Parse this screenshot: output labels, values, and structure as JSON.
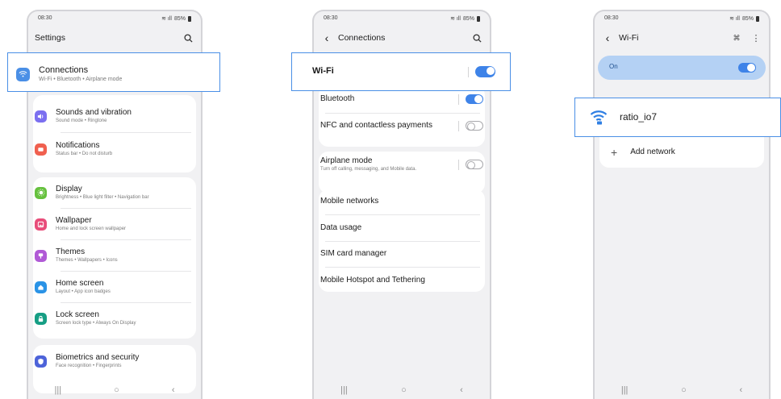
{
  "status_bar": {
    "time": "08:30",
    "battery": "85%"
  },
  "settings": {
    "title": "Settings",
    "items": [
      {
        "title": "Connections",
        "sub": "Wi-Fi  •  Bluetooth  •  Airplane mode",
        "icon": "wifi-icon",
        "color": "#4a8fe6"
      },
      {
        "title": "Sounds and vibration",
        "sub": "Sound mode  •  Ringtone",
        "icon": "speaker-icon",
        "color": "#7b6ff0"
      },
      {
        "title": "Notifications",
        "sub": "Status bar  •  Do not disturb",
        "icon": "notification-icon",
        "color": "#f0604f"
      },
      {
        "title": "Display",
        "sub": "Brightness  •  Blue light filter  •  Navigation bar",
        "icon": "sun-icon",
        "color": "#66c13e"
      },
      {
        "title": "Wallpaper",
        "sub": "Home and lock screen wallpaper",
        "icon": "image-icon",
        "color": "#e84d7a"
      },
      {
        "title": "Themes",
        "sub": "Themes  •  Wallpapers  •  Icons",
        "icon": "palette-icon",
        "color": "#b05ad6"
      },
      {
        "title": "Home screen",
        "sub": "Layout  •  App icon badges",
        "icon": "home-icon",
        "color": "#2a93e6"
      },
      {
        "title": "Lock screen",
        "sub": "Screen lock type  •  Always On Display",
        "icon": "lock-icon",
        "color": "#169e84"
      },
      {
        "title": "Biometrics and security",
        "sub": "Face recognition  •  Fingerprints",
        "icon": "shield-icon",
        "color": "#4d63d9"
      }
    ]
  },
  "connections": {
    "title": "Connections",
    "wifi": "Wi-Fi",
    "bluetooth": "Bluetooth",
    "nfc": "NFC and contactless payments",
    "airplane": "Airplane mode",
    "airplane_sub": "Turn off calling, messaging, and Mobile data.",
    "mobile_networks": "Mobile networks",
    "data_usage": "Data usage",
    "sim": "SIM card manager",
    "hotspot": "Mobile Hotspot and Tethering"
  },
  "wifi_screen": {
    "title": "Wi-Fi",
    "on_label": "On",
    "network": "ratio_io7",
    "add_network": "Add network"
  },
  "accent_color": "#3e83e8"
}
